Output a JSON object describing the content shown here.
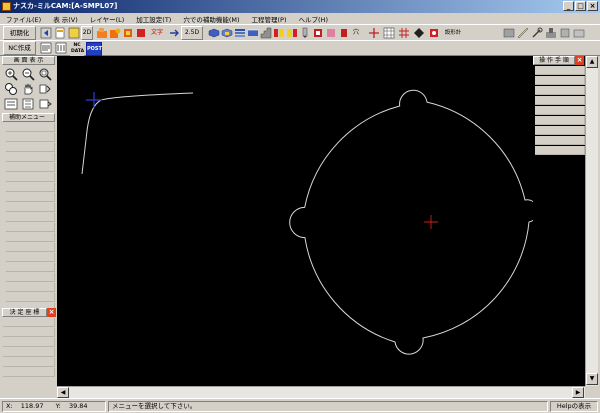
{
  "window": {
    "title": "ナスカ-ミルCAM:[A-SMPL07]",
    "minimize": "_",
    "maximize": "□",
    "close": "×"
  },
  "menu": [
    "ファイル(E)",
    "表 示(V)",
    "レイヤー(L)",
    "加工設定(T)",
    "穴での補助機能(M)",
    "工程管理(P)",
    "ヘルプ(H)"
  ],
  "toolbar1": {
    "init_label": "初期化",
    "d2": "2D",
    "moji": "文字",
    "d25": "2.5D",
    "ana": "穴",
    "calc": "設形計算"
  },
  "toolbar2": {
    "nc_label": "NC作成",
    "nc_data": "NC DATA",
    "post": "POST"
  },
  "left_panel": {
    "display_title": "画 面 表 示",
    "assist_title": "補助メニュー",
    "coord_title": "決 定 座 標",
    "close": "×",
    "icons": [
      "zoom-in",
      "zoom-out",
      "zoom-window",
      "zoom-fit",
      "pan",
      "redraw",
      "regen",
      "layers",
      "refresh"
    ]
  },
  "right_panel": {
    "title": "操 作 手 順",
    "close": "×"
  },
  "status": {
    "x_label": "X:",
    "x_value": "118.97",
    "y_label": "Y:",
    "y_value": "39.84",
    "message": "メニューを選択して下さい。",
    "help": "Helpの表示"
  }
}
